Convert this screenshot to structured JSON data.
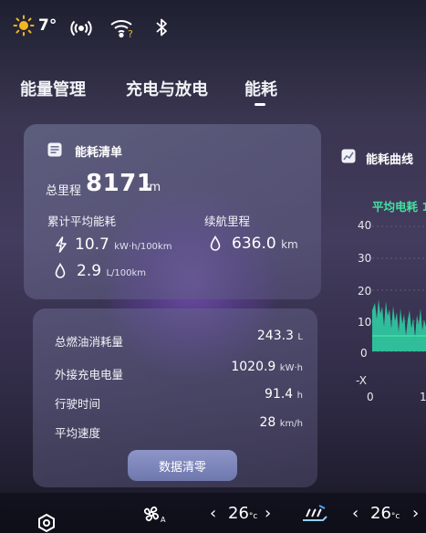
{
  "status": {
    "temperature": "7°",
    "icons": [
      "sun-icon",
      "hotspot-icon",
      "wifi-icon",
      "bluetooth-icon"
    ]
  },
  "tabs": [
    {
      "label": "能量管理",
      "active": false
    },
    {
      "label": "充电与放电",
      "active": false
    },
    {
      "label": "能耗",
      "active": true
    }
  ],
  "consumption_card": {
    "title": "能耗清单",
    "total_mileage_label": "总里程",
    "total_mileage_value": "8171",
    "total_mileage_unit": "km",
    "avg_consumption_label": "累计平均能耗",
    "electric_value": "10.7",
    "electric_unit": "kW·h/100km",
    "fuel_value": "2.9",
    "fuel_unit": "L/100km",
    "range_label": "续航里程",
    "range_value": "636.0",
    "range_unit": "km"
  },
  "stats_card": {
    "rows": [
      {
        "label": "总燃油消耗量",
        "value": "243.3",
        "unit": "L"
      },
      {
        "label": "外接充电电量",
        "value": "1020.9",
        "unit": "kW·h"
      },
      {
        "label": "行驶时间",
        "value": "91.4",
        "unit": "h"
      },
      {
        "label": "平均速度",
        "value": "28",
        "unit": "km/h"
      }
    ],
    "reset_button": "数据清零"
  },
  "chart_panel": {
    "title": "能耗曲线",
    "subtitle": "平均电耗",
    "subtitle_suffix": "1",
    "y_ticks": [
      "40",
      "30",
      "20",
      "10",
      "0",
      "-X"
    ],
    "x_ticks": [
      "0",
      "1"
    ]
  },
  "bottom_bar": {
    "left_temp": "26",
    "left_temp_unit": "°c",
    "right_temp": "26",
    "right_temp_unit": "°c"
  },
  "colors": {
    "accent_green": "#3fe2a0",
    "chart_fill": "#2fd6a8"
  }
}
